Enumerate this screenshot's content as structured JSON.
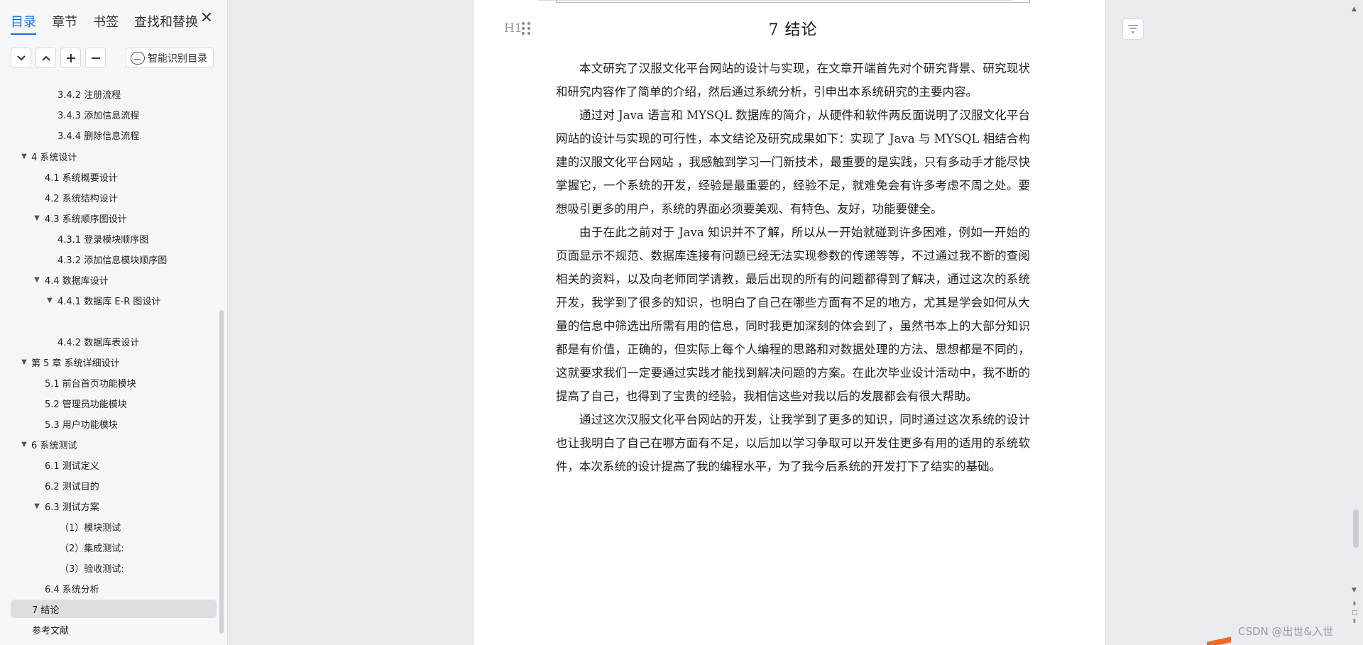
{
  "sidebar": {
    "tabs": [
      "目录",
      "章节",
      "书签",
      "查找和替换"
    ],
    "active_tab": "目录",
    "close_symbol": "✕",
    "smart_button_label": "智能识别目录",
    "toc": [
      {
        "label": "3.4.2 注册流程"
      },
      {
        "label": "3.4.3 添加信息流程"
      },
      {
        "label": "3.4.4 删除信息流程"
      },
      {
        "label": "4   系统设计"
      },
      {
        "label": "4.1 系统概要设计"
      },
      {
        "label": "4.2 系统结构设计"
      },
      {
        "label": "4.3 系统顺序图设计"
      },
      {
        "label": "4.3.1 登录模块顺序图"
      },
      {
        "label": "4.3.2 添加信息模块顺序图"
      },
      {
        "label": "4.4 数据库设计"
      },
      {
        "label": "4.4.1 数据库 E-R 图设计"
      },
      {
        "label": "4.4.2 数据库表设计"
      },
      {
        "label": "第 5 章  系统详细设计"
      },
      {
        "label": "5.1 前台首页功能模块"
      },
      {
        "label": "5.2 管理员功能模块"
      },
      {
        "label": "5.3 用户功能模块"
      },
      {
        "label": "6  系统测试"
      },
      {
        "label": "6.1  测试定义"
      },
      {
        "label": "6.2  测试目的"
      },
      {
        "label": "6.3 测试方案"
      },
      {
        "label": "（1）模块测试"
      },
      {
        "label": "（2）集成测试:"
      },
      {
        "label": "（3）验收测试:"
      },
      {
        "label": "6.4 系统分析"
      },
      {
        "label": "7  结论"
      },
      {
        "label": "参考文献"
      }
    ]
  },
  "document": {
    "heading_indicator": "H1",
    "chapter_title": "7  结论",
    "paragraphs": [
      "本文研究了汉服文化平台网站的设计与实现，在文章开端首先对个研究背景、研究现状和研究内容作了简单的介绍，然后通过系统分析，引申出本系统研究的主要内容。",
      "通过对 Java 语言和 MYSQL 数据库的简介，从硬件和软件两反面说明了汉服文化平台网站的设计与实现的可行性，本文结论及研究成果如下：实现了 Java 与 MYSQL 相结合构建的汉服文化平台网站 ，我感触到学习一门新技术，最重要的是实践，只有多动手才能尽快掌握它，一个系统的开发，经验是最重要的，经验不足，就难免会有许多考虑不周之处。要想吸引更多的用户，系统的界面必须要美观、有特色、友好，功能要健全。",
      "由于在此之前对于 Java 知识并不了解，所以从一开始就碰到许多困难，例如一开始的页面显示不规范、数据库连接有问题已经无法实现参数的传递等等，不过通过我不断的查阅相关的资料，以及向老师同学请教，最后出现的所有的问题都得到了解决，通过这次的系统开发，我学到了很多的知识，也明白了自己在哪些方面有不足的地方，尤其是学会如何从大量的信息中筛选出所需有用的信息，同时我更加深刻的体会到了，虽然书本上的大部分知识都是有价值，正确的，但实际上每个人编程的思路和对数据处理的方法、思想都是不同的，这就要求我们一定要通过实践才能找到解决问题的方案。在此次毕业设计活动中，我不断的提高了自己，也得到了宝贵的经验，我相信这些对我以后的发展都会有很大帮助。",
      "通过这次汉服文化平台网站的开发，让我学到了更多的知识，同时通过这次系统的设计也让我明白了自己在哪方面有不足，以后加以学习争取可以开发住更多有用的适用的系统软件，本次系统的设计提高了我的编程水平，为了我今后系统的开发打下了结实的基础。"
    ]
  },
  "watermark": "CSDN @出世&入世"
}
